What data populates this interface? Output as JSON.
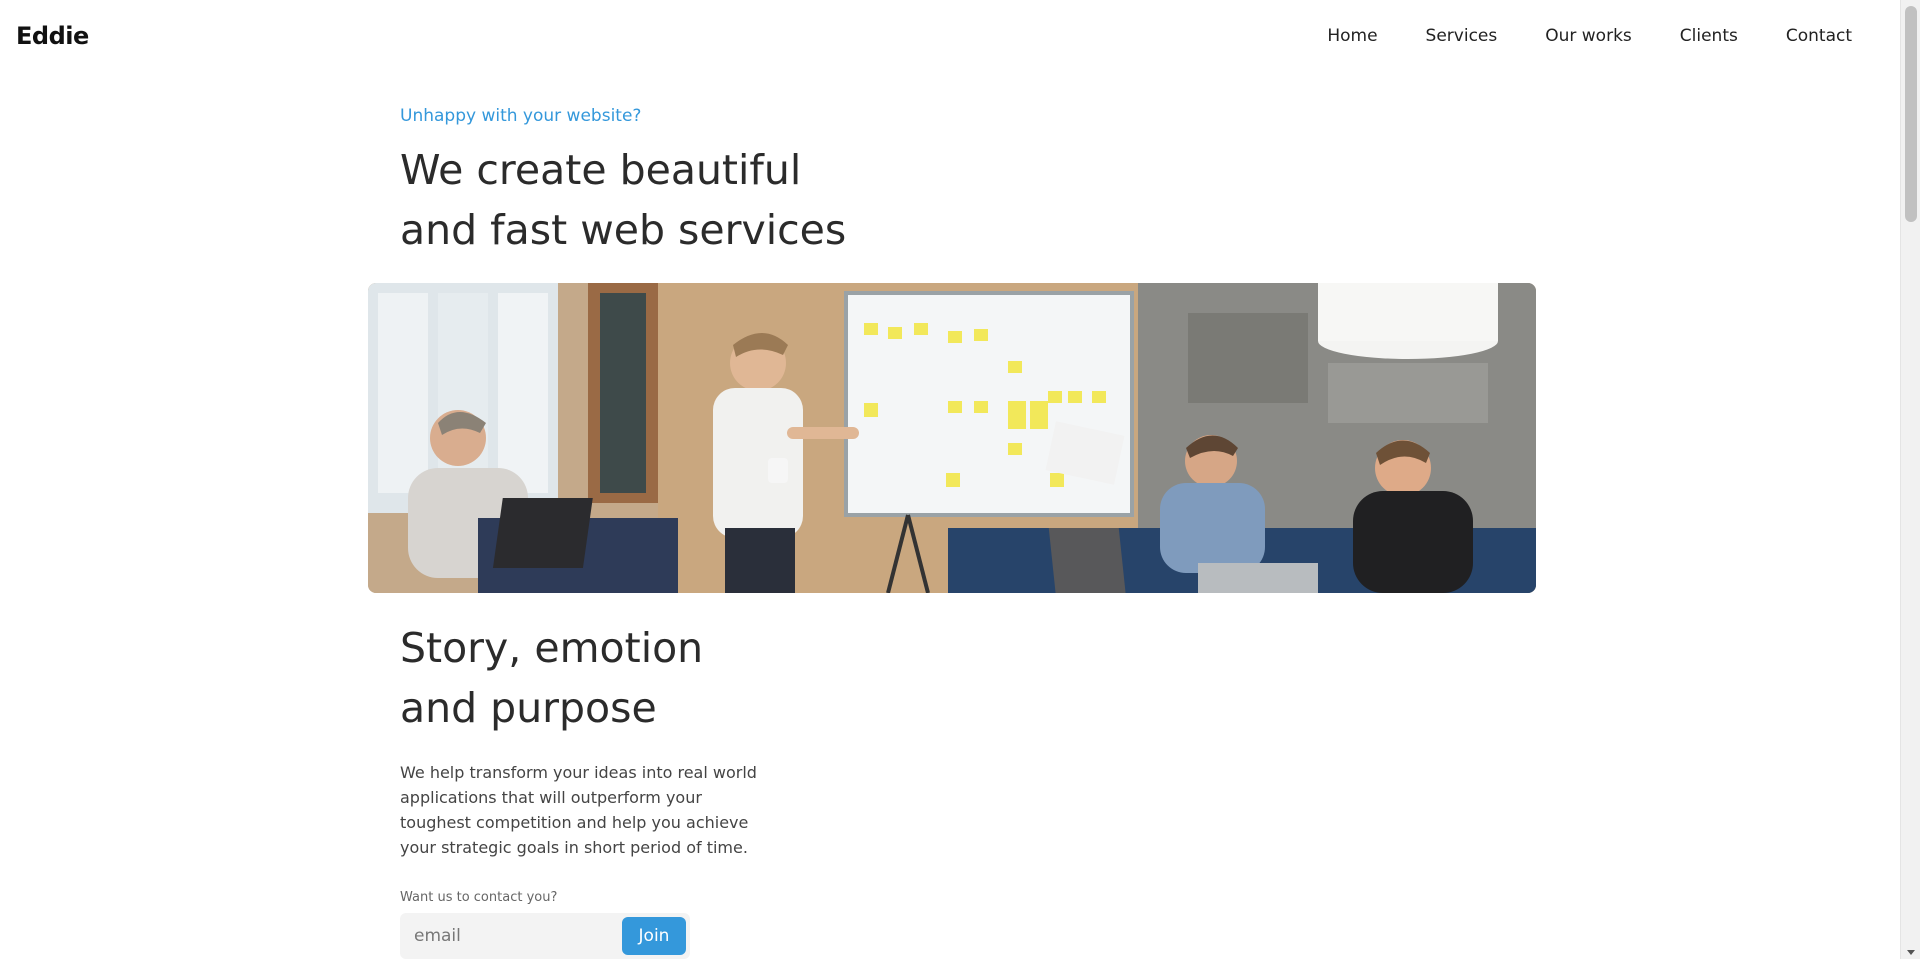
{
  "header": {
    "brand": "Eddie",
    "nav": [
      {
        "label": "Home"
      },
      {
        "label": "Services"
      },
      {
        "label": "Our works"
      },
      {
        "label": "Clients"
      },
      {
        "label": "Contact"
      }
    ]
  },
  "hero": {
    "eyebrow": "Unhappy with your website?",
    "title_line1": "We create beautiful",
    "title_line2": "and fast web services"
  },
  "story": {
    "title_line1": "Story, emotion",
    "title_line2": "and purpose",
    "text": "We help transform your ideas into real world applications that will outperform your toughest competition and help you achieve your strategic goals in short period of time.",
    "contact_label": "Want us to contact you?",
    "email_placeholder": "email",
    "join_label": "Join"
  },
  "colors": {
    "accent": "#3498db",
    "text": "#2b2b2b"
  }
}
